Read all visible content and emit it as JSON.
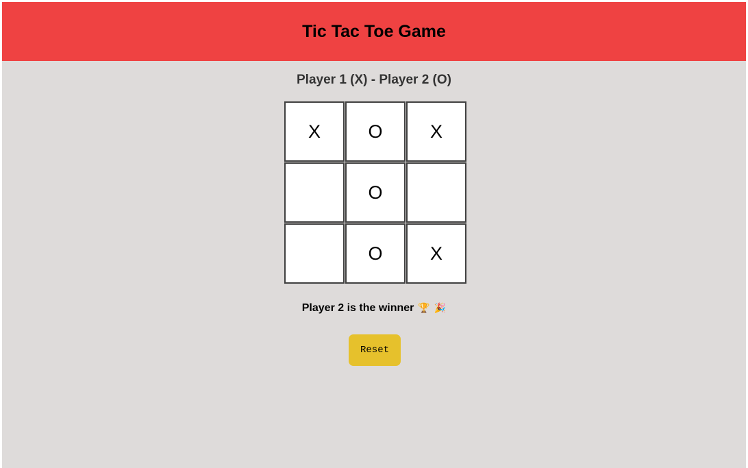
{
  "header": {
    "title": "Tic Tac Toe Game"
  },
  "players": {
    "label": "Player 1 (X) - Player 2 (O)"
  },
  "board": {
    "cells": [
      "X",
      "O",
      "X",
      "",
      "O",
      "",
      "",
      "O",
      "X"
    ]
  },
  "status": {
    "text": "Player 2 is the winner",
    "trophy": "🏆",
    "party": "🎉"
  },
  "controls": {
    "reset_label": "Reset"
  },
  "colors": {
    "header_bg": "#ef4242",
    "page_bg": "#dedbda",
    "button_bg": "#e6c12c"
  }
}
